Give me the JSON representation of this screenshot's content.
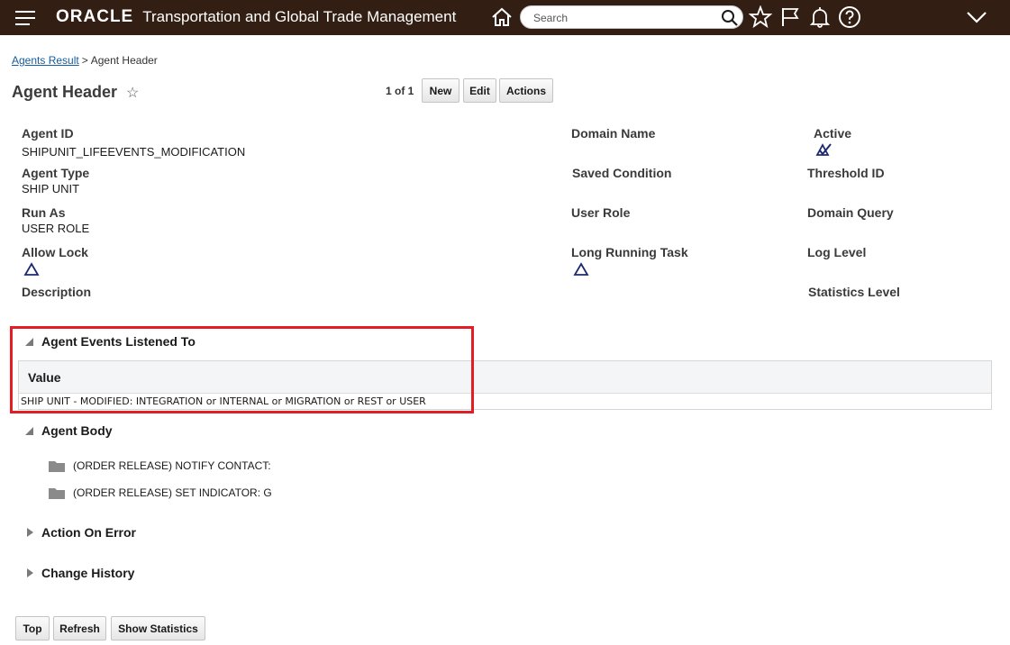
{
  "header": {
    "brand": "ORACLE",
    "product": "Transportation and Global Trade Management",
    "search_placeholder": "Search"
  },
  "breadcrumb": {
    "link": "Agents Result",
    "separator": ">",
    "current": "Agent Header"
  },
  "page": {
    "title": "Agent Header",
    "pager": "1 of 1",
    "buttons": {
      "new": "New",
      "edit": "Edit",
      "actions": "Actions"
    }
  },
  "fields": {
    "agent_id": {
      "label": "Agent ID",
      "value": "SHIPUNIT_LIFEEVENTS_MODIFICATION"
    },
    "agent_type": {
      "label": "Agent Type",
      "value": "SHIP UNIT"
    },
    "run_as": {
      "label": "Run As",
      "value": "USER ROLE"
    },
    "allow_lock": {
      "label": "Allow Lock"
    },
    "description": {
      "label": "Description"
    },
    "domain_name": {
      "label": "Domain Name"
    },
    "saved_condition": {
      "label": "Saved Condition"
    },
    "user_role": {
      "label": "User Role"
    },
    "long_running_task": {
      "label": "Long Running Task"
    },
    "active": {
      "label": "Active"
    },
    "threshold_id": {
      "label": "Threshold ID"
    },
    "domain_query": {
      "label": "Domain Query"
    },
    "log_level": {
      "label": "Log Level"
    },
    "statistics_level": {
      "label": "Statistics Level"
    }
  },
  "sections": {
    "events": {
      "title": "Agent Events Listened To",
      "column_header": "Value",
      "rows": [
        "SHIP UNIT - MODIFIED: INTEGRATION or INTERNAL or MIGRATION or REST or USER"
      ]
    },
    "body": {
      "title": "Agent Body",
      "items": [
        "(ORDER RELEASE) NOTIFY CONTACT:",
        "(ORDER RELEASE) SET INDICATOR: G"
      ]
    },
    "action_on_error": {
      "title": "Action On Error"
    },
    "change_history": {
      "title": "Change History"
    }
  },
  "footer": {
    "buttons": {
      "top": "Top",
      "refresh": "Refresh",
      "show_statistics": "Show Statistics"
    }
  },
  "colors": {
    "header_bg": "#331e13",
    "link": "#145c9e",
    "highlight": "#e01e24",
    "checkbox_icon": "#1c2a6e"
  }
}
